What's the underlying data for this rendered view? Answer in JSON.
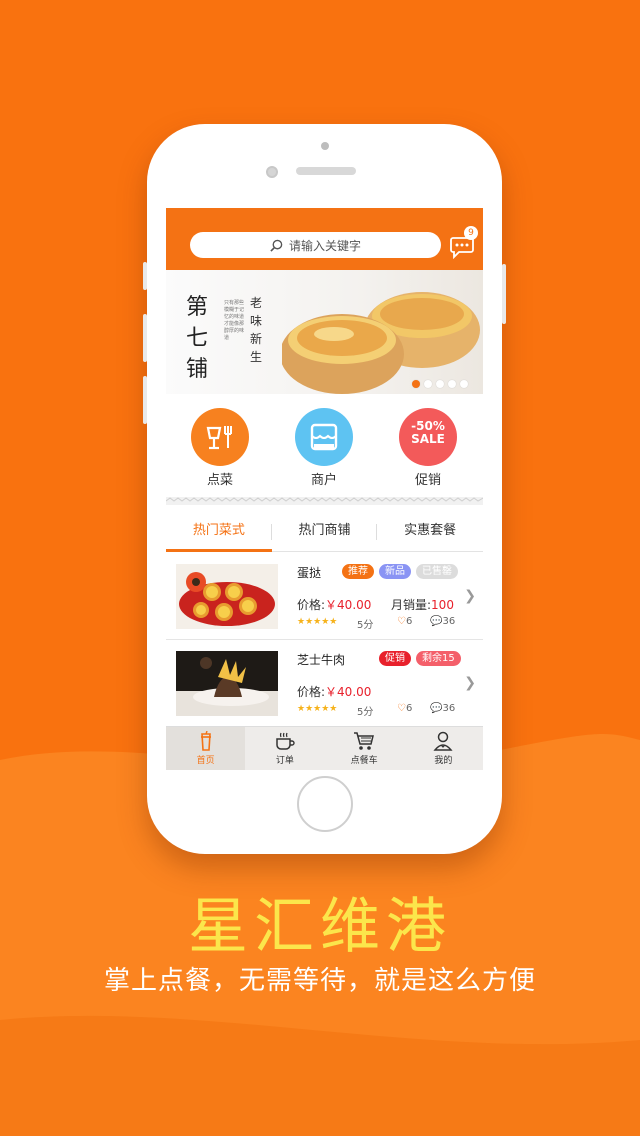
{
  "colors": {
    "brand": "#f47214",
    "background": "#f9720f",
    "price": "#e8212c",
    "headline": "#fbe64b"
  },
  "search": {
    "placeholder": "请输入关键字"
  },
  "messages": {
    "badge": "9"
  },
  "banner": {
    "title": "第七铺",
    "subtitle": "老味新生",
    "slide_count": 5,
    "active_slide": 1
  },
  "categories": [
    {
      "label": "点菜",
      "icon": "dining-icon",
      "color": "#f7811f"
    },
    {
      "label": "商户",
      "icon": "shop-icon",
      "color": "#5ec3f2"
    },
    {
      "label": "促销",
      "icon": "sale-badge-icon",
      "color": "#f35a5a",
      "badge_line1": "-50%",
      "badge_line2": "SALE"
    }
  ],
  "tabs": [
    "热门菜式",
    "热门商铺",
    "实惠套餐"
  ],
  "items": [
    {
      "name": "蛋挞",
      "tags": [
        {
          "text": "推荐",
          "color": "#f47214"
        },
        {
          "text": "新品",
          "color": "#8a94f4"
        },
        {
          "text": "已售罄",
          "color": "#dcdcdc"
        }
      ],
      "price_label": "价格:",
      "price": "￥40.00",
      "sales_label": "月销量:",
      "sales": "100",
      "rating": "5分",
      "stars": "★★★★★",
      "likes": "6",
      "comments": "36"
    },
    {
      "name": "芝士牛肉",
      "tags": [
        {
          "text": "促销",
          "color": "#e8212c"
        },
        {
          "text": "剩余15",
          "color": "#f45f6a"
        }
      ],
      "price_label": "价格:",
      "price": "￥40.00",
      "rating": "5分",
      "stars": "★★★★★",
      "likes": "6",
      "comments": "36"
    }
  ],
  "tabbar": [
    {
      "label": "首页",
      "icon": "cup-icon"
    },
    {
      "label": "订单",
      "icon": "coffee-icon"
    },
    {
      "label": "点餐车",
      "icon": "cart-icon"
    },
    {
      "label": "我的",
      "icon": "user-icon"
    }
  ],
  "marketing": {
    "title": "星汇维港",
    "tagline": "掌上点餐，无需等待，就是这么方便"
  }
}
